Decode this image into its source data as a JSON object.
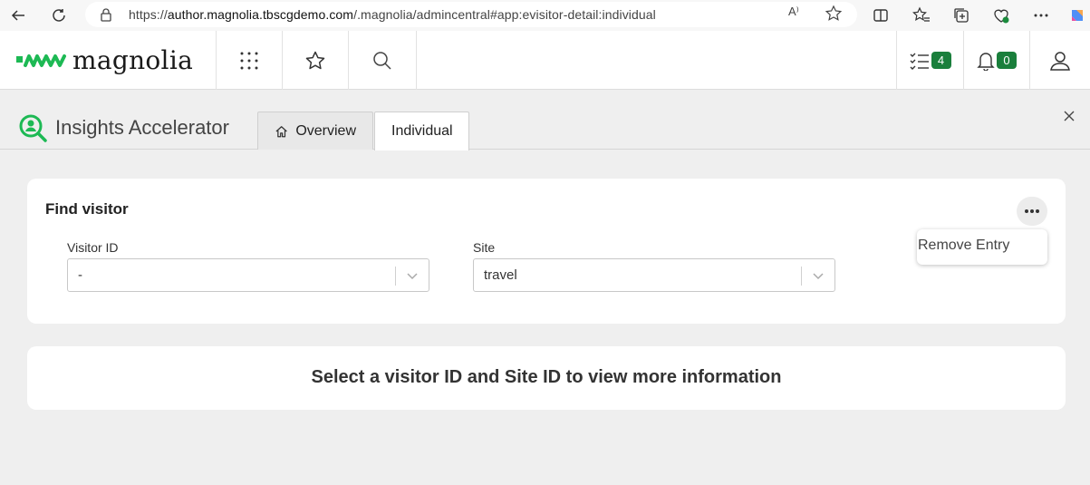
{
  "browser": {
    "url_prefix": "https://",
    "url_domain": "author.magnolia.tbscgdemo.com",
    "url_path": "/.magnolia/admincentral#app:evisitor-detail:individual",
    "read_aloud_label": "A⁾"
  },
  "header": {
    "logo_text": "magnolia",
    "tasks_count": "4",
    "notifications_count": "0"
  },
  "app": {
    "title": "Insights Accelerator",
    "tabs": [
      {
        "label": "Overview"
      },
      {
        "label": "Individual"
      }
    ]
  },
  "find_visitor": {
    "title": "Find visitor",
    "visitor_id_label": "Visitor ID",
    "visitor_id_value": "-",
    "site_label": "Site",
    "site_value": "travel",
    "menu_item": "Remove Entry"
  },
  "info": {
    "message": "Select a visitor ID and Site ID to view more information"
  },
  "colors": {
    "brand_green": "#1a7f3c",
    "logo_green": "#1db954",
    "background": "#efefef"
  }
}
